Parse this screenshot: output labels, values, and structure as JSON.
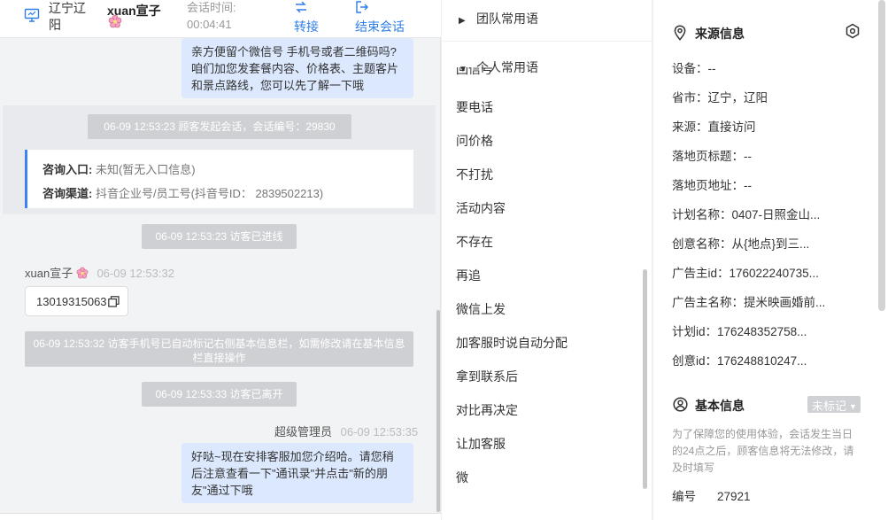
{
  "header": {
    "location": "辽宁辽阳",
    "visitor_name": "xuan宣子",
    "session_time_label": "会话时间:",
    "session_time": "00:04:41",
    "transfer_label": "转接",
    "end_label": "结束会话"
  },
  "chat": {
    "msg_agent_top": "亲方便留个微信号 手机号或者二维码吗?咱们加您发套餐内容、价格表、主题客片和景点路线，您可以先了解一下哦",
    "sys_session_start": "06-09 12:53:23 顾客发起会话，会话编号：29830",
    "consult_entry_label": "咨询入口:",
    "consult_entry_value": " 未知(暂无入口信息)",
    "consult_channel_label": "咨询渠道:",
    "consult_channel_value": " 抖音企业号/员工号(抖音号ID： 2839502213)",
    "sys_visitor_in": "06-09 12:53:23 访客已进线",
    "visitor_sender": "xuan宣子",
    "visitor_time": "06-09 12:53:32",
    "visitor_phone": "13019315063",
    "sys_phone_marked": "06-09 12:53:32 访客手机号已自动标记右侧基本信息栏，如需修改请在基本信息栏直接操作",
    "sys_visitor_left": "06-09 12:53:33 访客已离开",
    "agent_sender": "超级管理员",
    "agent_time": "06-09 12:53:35",
    "msg_agent_bottom": "好哒~现在安排客服加您介绍哈。请您稍后注意查看一下\"通讯录\"并点击\"新的朋友\"通过下哦"
  },
  "phrases": {
    "team_group": "团队常用语",
    "personal_group": "个人常用语",
    "partial_item": "回信号",
    "items": [
      "要电话",
      "问价格",
      "不打扰",
      "活动内容",
      "不存在",
      "再追",
      "微信上发",
      "加客服时说自动分配",
      "拿到联系后",
      "对比再决定",
      "让加客服",
      "微"
    ]
  },
  "info": {
    "source_title": "来源信息",
    "device": "设备：--",
    "province": "省市：辽宁，辽阳",
    "source": "来源：直接访问",
    "landing_title": "落地页标题：--",
    "landing_url": "落地页地址：--",
    "plan_name": "计划名称：0407-日照金山...",
    "creative_name": "创意名称：从{地点}到三...",
    "advertiser_id": "广告主id：176022240735...",
    "advertiser_name": "广告主名称：提米映画婚前...",
    "plan_id": "计划id：176248352758...",
    "creative_id": "创意id：176248810247...",
    "basic_title": "基本信息",
    "unmarked_badge": "未标记",
    "note": "为了保障您的使用体验，会话发生当日的24点之后，顾客信息将无法修改，请及时填写",
    "code_label": "编号",
    "code_value": "27921"
  },
  "colors": {
    "accent": "#2f7fe6",
    "bubble": "#dbe8fe",
    "system_tag": "#cfd0d3",
    "card_bar": "#3b82f6"
  },
  "icons": [
    "monitor-icon",
    "flower-icon",
    "transfer-icon",
    "exit-icon",
    "copy-icon",
    "location-pin-icon",
    "settings-icon",
    "user-circle-icon",
    "caret-down-icon",
    "triangle-right-icon",
    "triangle-down-icon"
  ]
}
